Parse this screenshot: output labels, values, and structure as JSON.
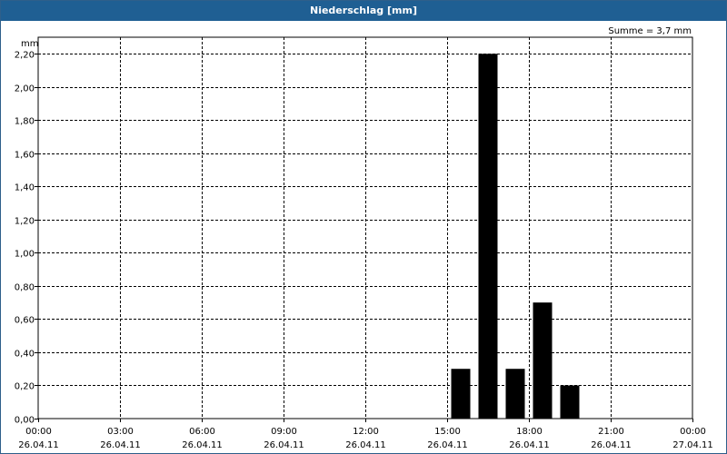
{
  "window": {
    "title": "Niederschlag [mm]"
  },
  "chart_data": {
    "type": "bar",
    "title": "Niederschlag [mm]",
    "ylabel": "mm",
    "xlabel": "",
    "ylim": [
      0,
      2.3
    ],
    "yticks": [
      "0,00",
      "0,20",
      "0,40",
      "0,60",
      "0,80",
      "1,00",
      "1,20",
      "1,40",
      "1,60",
      "1,80",
      "2,00",
      "2,20"
    ],
    "ytick_values": [
      0,
      0.2,
      0.4,
      0.6,
      0.8,
      1.0,
      1.2,
      1.4,
      1.6,
      1.8,
      2.0,
      2.2
    ],
    "xticks": [
      {
        "h": 0,
        "time": "00:00",
        "date": "26.04.11"
      },
      {
        "h": 3,
        "time": "03:00",
        "date": "26.04.11"
      },
      {
        "h": 6,
        "time": "06:00",
        "date": "26.04.11"
      },
      {
        "h": 9,
        "time": "09:00",
        "date": "26.04.11"
      },
      {
        "h": 12,
        "time": "12:00",
        "date": "26.04.11"
      },
      {
        "h": 15,
        "time": "15:00",
        "date": "26.04.11"
      },
      {
        "h": 18,
        "time": "18:00",
        "date": "26.04.11"
      },
      {
        "h": 21,
        "time": "21:00",
        "date": "26.04.11"
      },
      {
        "h": 24,
        "time": "00:00",
        "date": "27.04.11"
      }
    ],
    "xlim_hours": [
      0,
      24
    ],
    "bars": [
      {
        "start_h": 15,
        "end_h": 16,
        "value": 0.3
      },
      {
        "start_h": 16,
        "end_h": 17,
        "value": 2.2
      },
      {
        "start_h": 17,
        "end_h": 18,
        "value": 0.3
      },
      {
        "start_h": 18,
        "end_h": 19,
        "value": 0.7
      },
      {
        "start_h": 19,
        "end_h": 20,
        "value": 0.2
      }
    ],
    "annotation": "Summe = 3,7 mm",
    "grid": true,
    "bar_color": "#000000"
  }
}
